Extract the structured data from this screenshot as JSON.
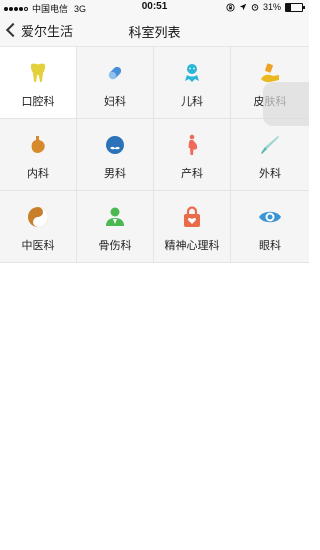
{
  "status_bar": {
    "carrier": "中国电信",
    "network": "3G",
    "time": "00:51",
    "battery_percent_text": "31%",
    "battery_level": 0.31
  },
  "nav": {
    "back_label": "爱尔生活",
    "title": "科室列表"
  },
  "departments": [
    {
      "label": "口腔科",
      "icon": "tooth-icon",
      "color": "#e3d03a"
    },
    {
      "label": "妇科",
      "icon": "capsule-icon",
      "color": "#4a8fd6"
    },
    {
      "label": "儿科",
      "icon": "baby-icon",
      "color": "#2bb5d6"
    },
    {
      "label": "皮肤科",
      "icon": "hand-cream-icon",
      "color": "#e9b91f"
    },
    {
      "label": "内科",
      "icon": "stomach-icon",
      "color": "#d68a2c"
    },
    {
      "label": "男科",
      "icon": "male-face-icon",
      "color": "#2c72b8"
    },
    {
      "label": "产科",
      "icon": "pregnant-icon",
      "color": "#ef6b58"
    },
    {
      "label": "外科",
      "icon": "scalpel-icon",
      "color": "#5ab8b0"
    },
    {
      "label": "中医科",
      "icon": "yin-yang-icon",
      "color": "#c97e2a"
    },
    {
      "label": "骨伤科",
      "icon": "doctor-icon",
      "color": "#4bb851"
    },
    {
      "label": "精神心理科",
      "icon": "heart-lock-icon",
      "color": "#ea6a4a"
    },
    {
      "label": "眼科",
      "icon": "eye-icon",
      "color": "#3a94d8"
    }
  ]
}
